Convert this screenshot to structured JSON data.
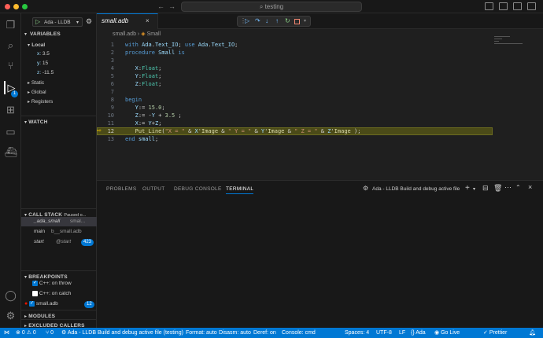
{
  "window": {
    "search_text": "testing"
  },
  "debug_toolbar": {
    "config": "Ada - LLDB"
  },
  "sidebar": {
    "variables_title": "VARIABLES",
    "local_label": "Local",
    "vars": [
      {
        "name": "x:",
        "value": "3.5"
      },
      {
        "name": "y:",
        "value": "15"
      },
      {
        "name": "z:",
        "value": "-11.5"
      }
    ],
    "scopes": [
      "Static",
      "Global",
      "Registers"
    ],
    "watch_title": "WATCH",
    "callstack_title": "CALL STACK",
    "callstack_status": "Paused o...",
    "frames": [
      {
        "fn": "_ada_small",
        "file": "smal..."
      },
      {
        "fn": "main",
        "file": "b__small.adb"
      },
      {
        "fn": "start",
        "file": "@start",
        "badge": "423"
      }
    ],
    "breakpoints_title": "BREAKPOINTS",
    "breakpoints": [
      {
        "label": "C++: on throw",
        "checked": true
      },
      {
        "label": "C++: on catch",
        "checked": false
      },
      {
        "label": "small.adb",
        "checked": true,
        "badge": "12"
      }
    ],
    "modules_title": "MODULES",
    "excluded_title": "EXCLUDED CALLERS"
  },
  "editor": {
    "tab_label": "small.adb",
    "breadcrumb_file": "small.adb",
    "breadcrumb_symbol": "Small",
    "current_line": 12,
    "lines": [
      {
        "n": "1",
        "code": "with Ada.Text_IO; use Ada.Text_IO;"
      },
      {
        "n": "2",
        "code": "procedure Small is"
      },
      {
        "n": "3",
        "code": ""
      },
      {
        "n": "4",
        "code": "   X:Float;"
      },
      {
        "n": "5",
        "code": "   Y:Float;"
      },
      {
        "n": "6",
        "code": "   Z:Float;"
      },
      {
        "n": "7",
        "code": ""
      },
      {
        "n": "8",
        "code": "begin"
      },
      {
        "n": "9",
        "code": "   Y:= 15.0;"
      },
      {
        "n": "10",
        "code": "   Z:= -Y + 3.5 ;"
      },
      {
        "n": "11",
        "code": "   X:= Y+Z;"
      },
      {
        "n": "12",
        "code": "   Put_Line(\"X = \" & X'Image & \" Y = \" & Y'Image & \" Z = \" & Z'Image );"
      },
      {
        "n": "13",
        "code": "end small;"
      }
    ]
  },
  "panel": {
    "tabs": [
      "PROBLEMS",
      "OUTPUT",
      "DEBUG CONSOLE",
      "TERMINAL"
    ],
    "active_tab": "TERMINAL",
    "terminal_title": "Ada - LLDB Build and debug active file"
  },
  "status": {
    "errors": "0",
    "warnings": "0",
    "ports": "0",
    "debug": "Ada - LLDB Build and debug active file (testing)",
    "format": "Format: auto",
    "disasm": "Disasm: auto",
    "deref": "Deref: on",
    "console": "Console: cmd",
    "spaces": "Spaces: 4",
    "encoding": "UTF-8",
    "eol": "LF",
    "lang": "Ada",
    "golive": "Go Live",
    "prettier": "Prettier"
  }
}
